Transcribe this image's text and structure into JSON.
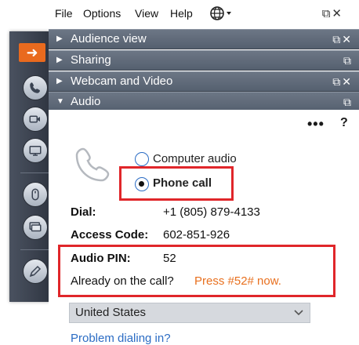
{
  "menu": {
    "file": "File",
    "options": "Options",
    "view": "View",
    "help": "Help",
    "window_controls": "⧉✕"
  },
  "sections": [
    {
      "label": "Audience view",
      "controls": "⧉✕"
    },
    {
      "label": "Sharing",
      "controls": "⧉"
    },
    {
      "label": "Webcam and Video",
      "controls": "⧉✕"
    },
    {
      "label": "Audio",
      "controls": "⧉"
    }
  ],
  "audio": {
    "more": "•••",
    "help": "?",
    "options": [
      {
        "label": "Computer audio",
        "selected": false
      },
      {
        "label": "Phone call",
        "selected": true
      }
    ],
    "dial_label": "Dial:",
    "dial_value": "+1 (805) 879-4133",
    "access_label": "Access Code:",
    "access_value": "602-851-926",
    "pin_label": "Audio PIN:",
    "pin_value": "52",
    "already_text": "Already on the call?",
    "press_text": "Press #52# now.",
    "country": "United States",
    "problem_link": "Problem dialing in?"
  },
  "icons": [
    "arrow-right-icon",
    "phone-icon",
    "camera-icon",
    "screen-icon",
    "mouse-icon",
    "monitor-icon",
    "pencil-icon",
    "globe-icon"
  ],
  "colors": {
    "accent_orange": "#e96a1e",
    "link_blue": "#2b6cc4",
    "highlight_red": "#e0262a",
    "header_gray": "#5f6a79"
  }
}
